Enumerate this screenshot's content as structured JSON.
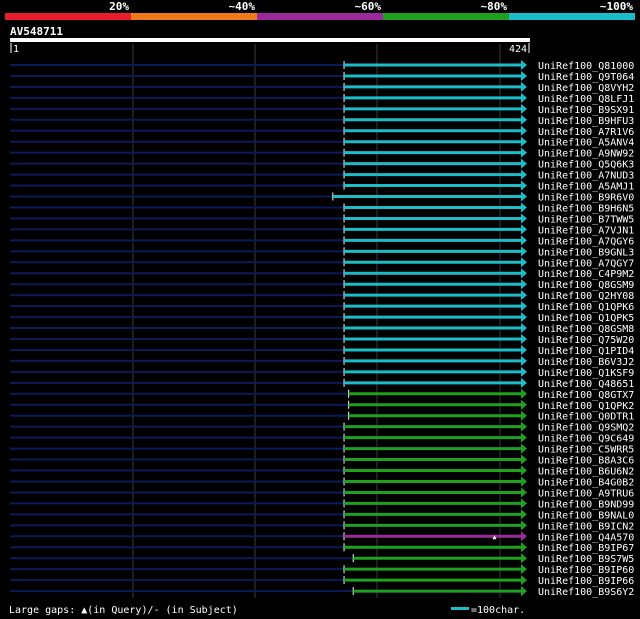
{
  "legend": {
    "labels": [
      "20%",
      "~40%",
      "~60%",
      "~80%",
      "~100%"
    ],
    "colors": [
      "#e81e2a",
      "#ef7a1c",
      "#9a2a9a",
      "#1fa01f",
      "#1bbdc8"
    ]
  },
  "query": {
    "id": "AV548711",
    "start": "1",
    "end": "424"
  },
  "footer": {
    "gaps_text": "Large gaps: ▲(in Query)/- (in Subject)",
    "scale_text": "=100char."
  },
  "colors": {
    "background": "#000000",
    "line_bg": "#0b1b5a",
    "grid": "#444444",
    "white": "#ffffff"
  },
  "hits": [
    {
      "name": "UniRef100_Q81000",
      "level": 4,
      "start": 0.655
    },
    {
      "name": "UniRef100_Q9T064",
      "level": 4,
      "start": 0.655
    },
    {
      "name": "UniRef100_Q8VYH2",
      "level": 4,
      "start": 0.655
    },
    {
      "name": "UniRef100_Q8LFJ1",
      "level": 4,
      "start": 0.655
    },
    {
      "name": "UniRef100_B9SX91",
      "level": 4,
      "start": 0.655
    },
    {
      "name": "UniRef100_B9HFU3",
      "level": 4,
      "start": 0.655
    },
    {
      "name": "UniRef100_A7R1V6",
      "level": 4,
      "start": 0.655
    },
    {
      "name": "UniRef100_A5ANV4",
      "level": 4,
      "start": 0.655
    },
    {
      "name": "UniRef100_A9NW92",
      "level": 4,
      "start": 0.655
    },
    {
      "name": "UniRef100_Q5Q6K3",
      "level": 4,
      "start": 0.655
    },
    {
      "name": "UniRef100_A7NUD3",
      "level": 4,
      "start": 0.655
    },
    {
      "name": "UniRef100_A5AMJ1",
      "level": 4,
      "start": 0.655
    },
    {
      "name": "UniRef100_B9R6V0",
      "level": 4,
      "start": 0.633
    },
    {
      "name": "UniRef100_B9H6N5",
      "level": 4,
      "start": 0.655
    },
    {
      "name": "UniRef100_B7TWW5",
      "level": 4,
      "start": 0.655
    },
    {
      "name": "UniRef100_A7VJN1",
      "level": 4,
      "start": 0.655
    },
    {
      "name": "UniRef100_A7QGY6",
      "level": 4,
      "start": 0.655
    },
    {
      "name": "UniRef100_B9GNL3",
      "level": 4,
      "start": 0.655
    },
    {
      "name": "UniRef100_A7QGY7",
      "level": 4,
      "start": 0.655
    },
    {
      "name": "UniRef100_C4P9M2",
      "level": 4,
      "start": 0.655
    },
    {
      "name": "UniRef100_Q8GSM9",
      "level": 4,
      "start": 0.655
    },
    {
      "name": "UniRef100_Q2HY08",
      "level": 4,
      "start": 0.655
    },
    {
      "name": "UniRef100_Q1QPK6",
      "level": 4,
      "start": 0.655
    },
    {
      "name": "UniRef100_Q1QPK5",
      "level": 4,
      "start": 0.655
    },
    {
      "name": "UniRef100_Q8GSM8",
      "level": 4,
      "start": 0.655
    },
    {
      "name": "UniRef100_Q75W20",
      "level": 4,
      "start": 0.655
    },
    {
      "name": "UniRef100_Q1PID4",
      "level": 4,
      "start": 0.655
    },
    {
      "name": "UniRef100_B6V3J2",
      "level": 4,
      "start": 0.655
    },
    {
      "name": "UniRef100_Q1KSF9",
      "level": 4,
      "start": 0.655
    },
    {
      "name": "UniRef100_Q48651",
      "level": 4,
      "start": 0.655
    },
    {
      "name": "UniRef100_Q8GTX7",
      "level": 3,
      "start": 0.664
    },
    {
      "name": "UniRef100_Q1QPK2",
      "level": 3,
      "start": 0.664
    },
    {
      "name": "UniRef100_Q0DTR1",
      "level": 3,
      "start": 0.664
    },
    {
      "name": "UniRef100_Q9SMQ2",
      "level": 3,
      "start": 0.655
    },
    {
      "name": "UniRef100_Q9C649",
      "level": 3,
      "start": 0.655
    },
    {
      "name": "UniRef100_C5WRR5",
      "level": 3,
      "start": 0.655
    },
    {
      "name": "UniRef100_B8A3C6",
      "level": 3,
      "start": 0.655
    },
    {
      "name": "UniRef100_B6U6N2",
      "level": 3,
      "start": 0.655
    },
    {
      "name": "UniRef100_B4G0B2",
      "level": 3,
      "start": 0.655
    },
    {
      "name": "UniRef100_A9TRU6",
      "level": 3,
      "start": 0.655
    },
    {
      "name": "UniRef100_B9ND99",
      "level": 3,
      "start": 0.655
    },
    {
      "name": "UniRef100_B9NAL0",
      "level": 3,
      "start": 0.655
    },
    {
      "name": "UniRef100_B9ICN2",
      "level": 3,
      "start": 0.655
    },
    {
      "name": "UniRef100_Q4A570",
      "level": 2,
      "start": 0.655,
      "gap": 0.95
    },
    {
      "name": "UniRef100_B9IP67",
      "level": 3,
      "start": 0.655
    },
    {
      "name": "UniRef100_B9S7W5",
      "level": 3,
      "start": 0.673
    },
    {
      "name": "UniRef100_B9IP60",
      "level": 3,
      "start": 0.655
    },
    {
      "name": "UniRef100_B9IP66",
      "level": 3,
      "start": 0.655
    },
    {
      "name": "UniRef100_B9S6Y2",
      "level": 3,
      "start": 0.673
    }
  ]
}
